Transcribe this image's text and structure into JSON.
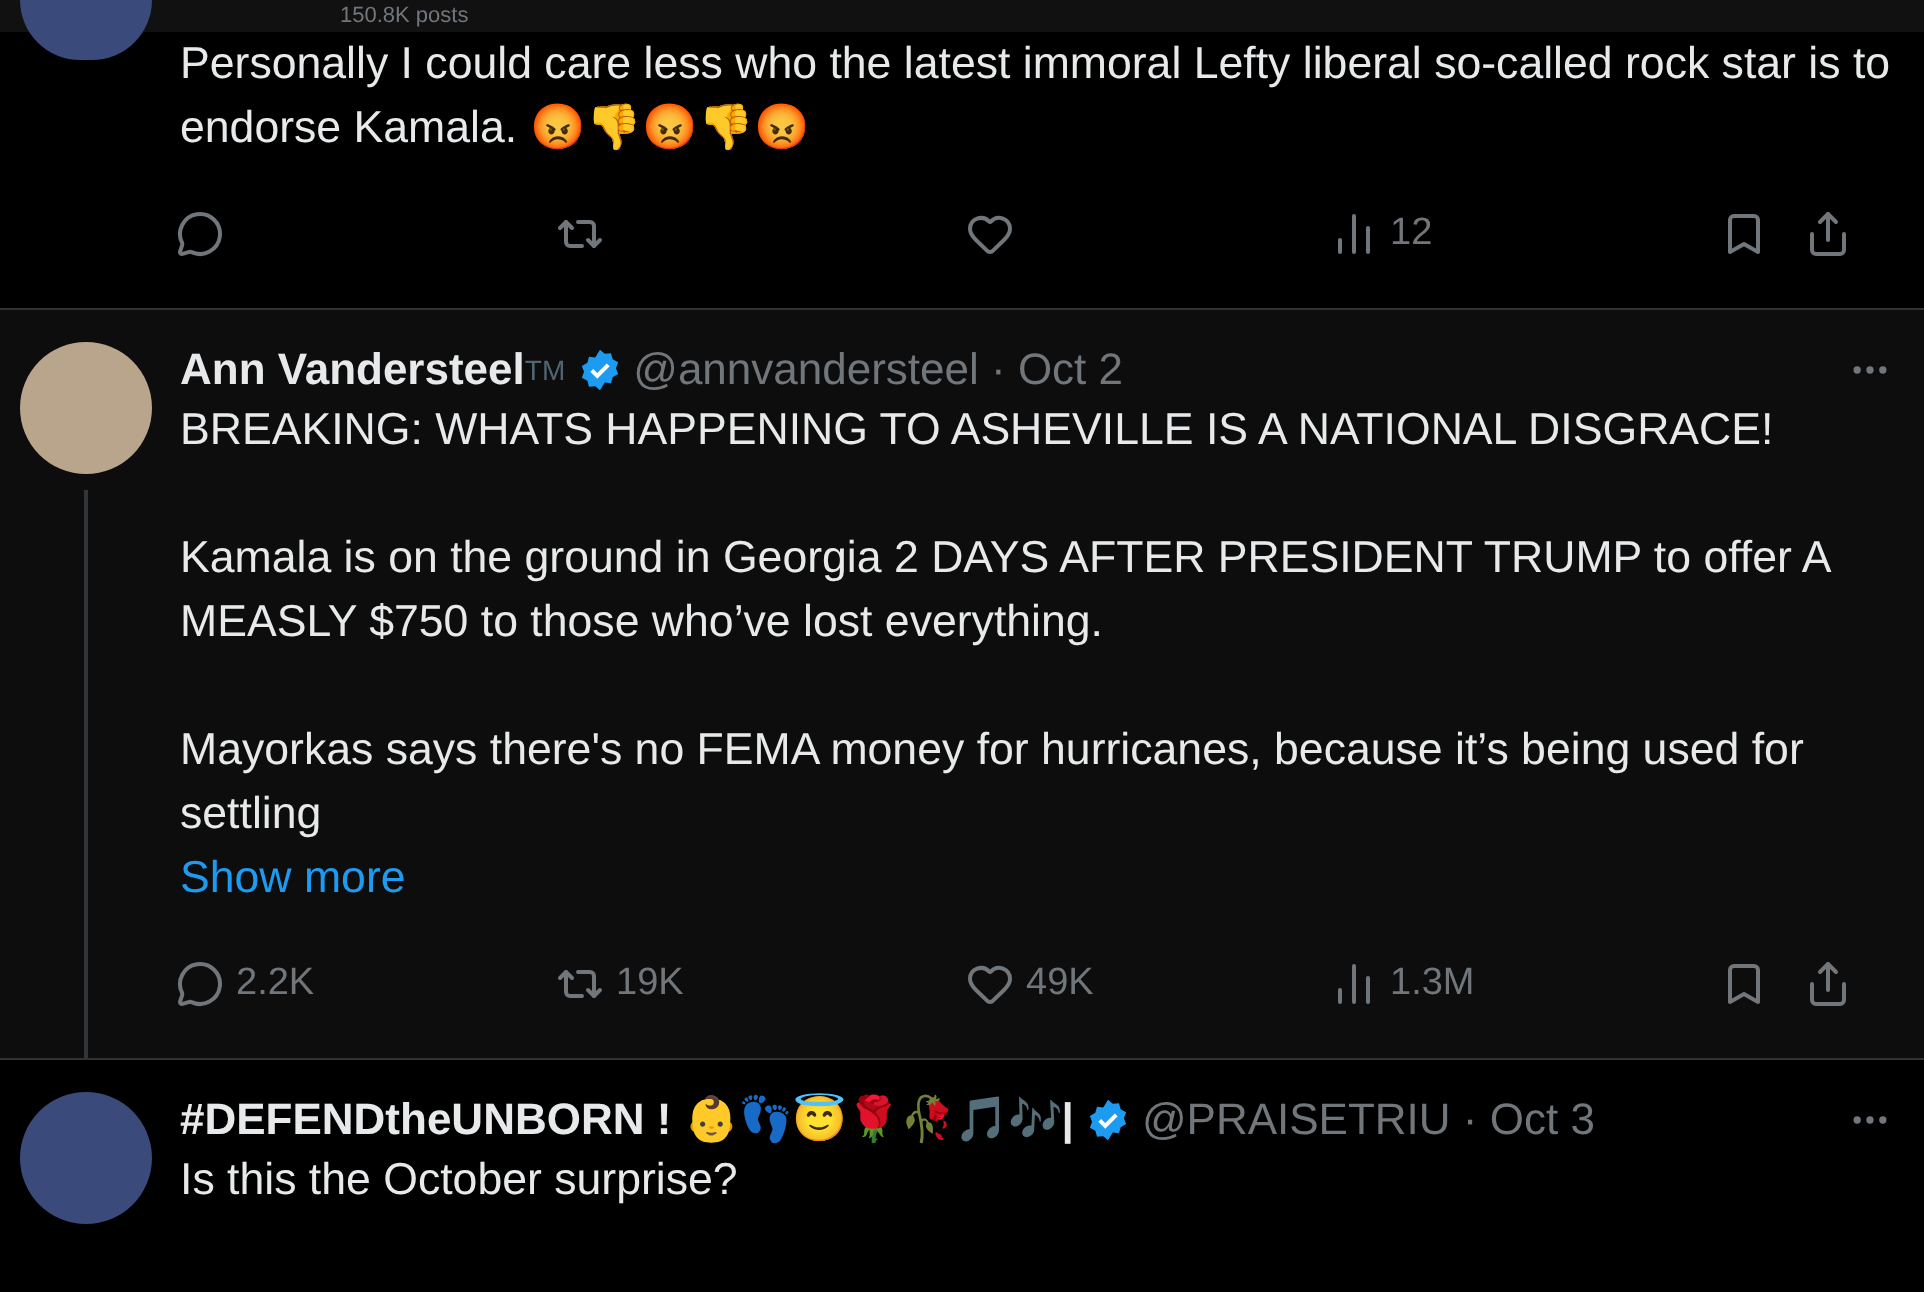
{
  "header": {
    "post_count": "150.8K posts"
  },
  "tweets": [
    {
      "highlighted": false,
      "thread_line": false,
      "paragraphs": [
        "Personally I could care less who the latest immoral Lefty liberal so-called rock star is to endorse Kamala. 😡👎😡👎😡"
      ],
      "stats": {
        "views": "12"
      }
    },
    {
      "name": "Ann Vandersteel",
      "name_suffix": "TM",
      "handle": "@annvandersteel · Oct 2",
      "verified": true,
      "highlighted": true,
      "thread_line": true,
      "paragraphs": [
        "BREAKING: WHATS HAPPENING TO ASHEVILLE IS A NATIONAL DISGRACE!",
        "Kamala is on the ground in Georgia 2 DAYS AFTER PRESIDENT TRUMP to offer A MEASLY $750 to those who’ve lost everything.",
        "Mayorkas says there's no FEMA money for hurricanes, because it’s being used for settling"
      ],
      "show_more": "Show more",
      "stats": {
        "replies": "2.2K",
        "reposts": "19K",
        "likes": "49K",
        "views": "1.3M"
      }
    },
    {
      "name": "#DEFENDtheUNBORN ! 👶👣😇🌹🥀🎵🎶|",
      "handle": "@PRAISETRIU · Oct 3",
      "verified": true,
      "highlighted": false,
      "thread_line": false,
      "paragraphs": [
        "Is this the October surprise?"
      ]
    }
  ]
}
